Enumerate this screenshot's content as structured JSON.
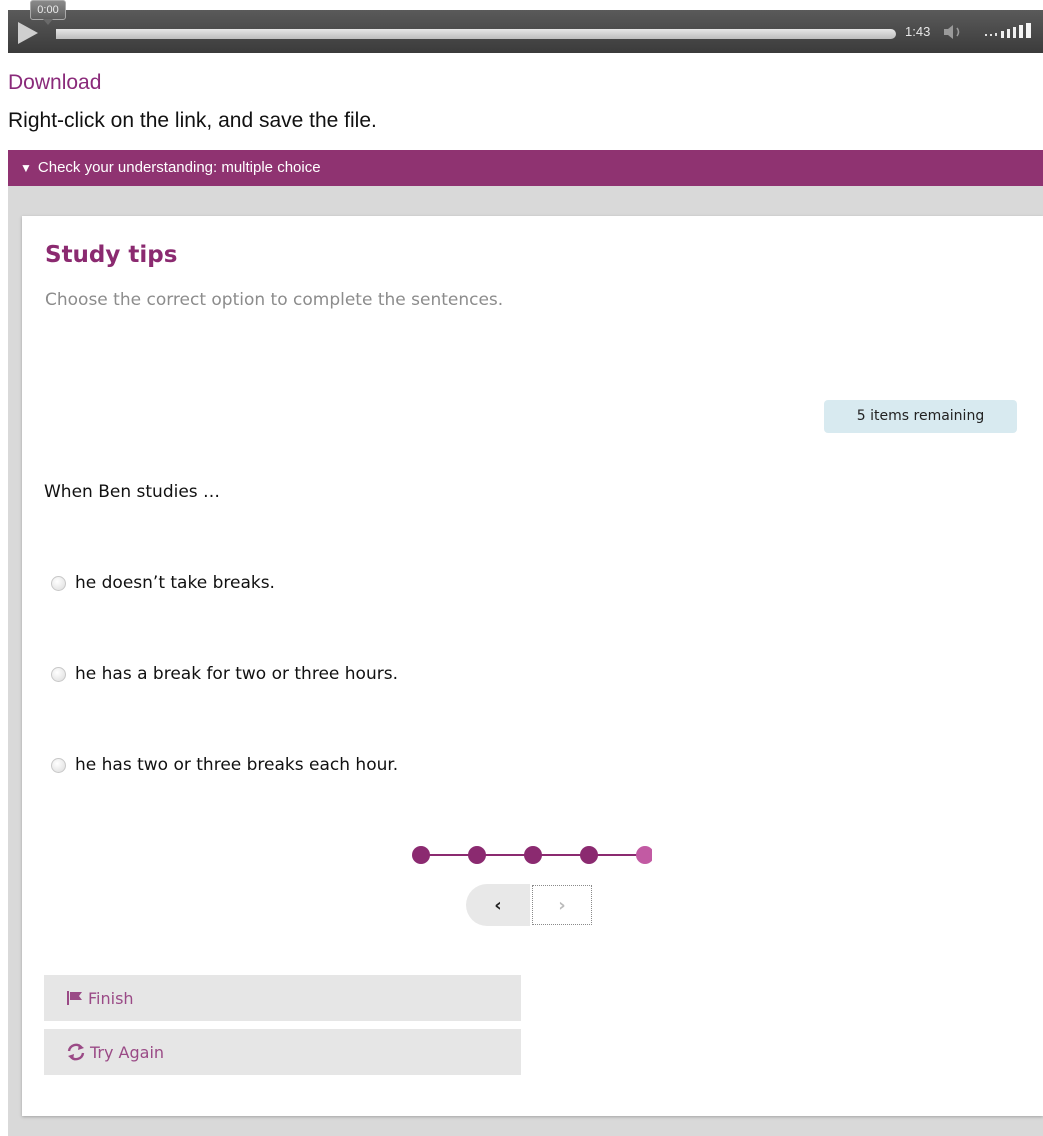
{
  "player": {
    "current_time": "0:00",
    "duration": "1:43",
    "icons": {
      "play": "play-icon",
      "volume": "volume-icon",
      "volume_level": "volume-level-icon"
    }
  },
  "download": {
    "link_label": "Download",
    "note": "Right-click on the link, and save the file."
  },
  "accordion": {
    "toggle_icon": "▼",
    "label": "Check your understanding: multiple choice"
  },
  "quiz": {
    "title": "Study tips",
    "instruction": "Choose the correct option to complete the sentences.",
    "remaining": "5 items remaining",
    "question": "When Ben studies …",
    "options": [
      {
        "label": "he doesn’t take breaks."
      },
      {
        "label": "he has a break for two or three hours."
      },
      {
        "label": "he has two or three breaks each hour."
      }
    ],
    "progress": {
      "total": 5,
      "current": 5
    },
    "colors": {
      "accent": "#8b2a70",
      "progress_current": "#c25aa3",
      "progress_done": "#8b2a70"
    },
    "nav": {
      "prev_glyph": "‹",
      "next_glyph": "›"
    },
    "actions": {
      "finish_label": "Finish",
      "try_again_label": "Try Again"
    }
  }
}
